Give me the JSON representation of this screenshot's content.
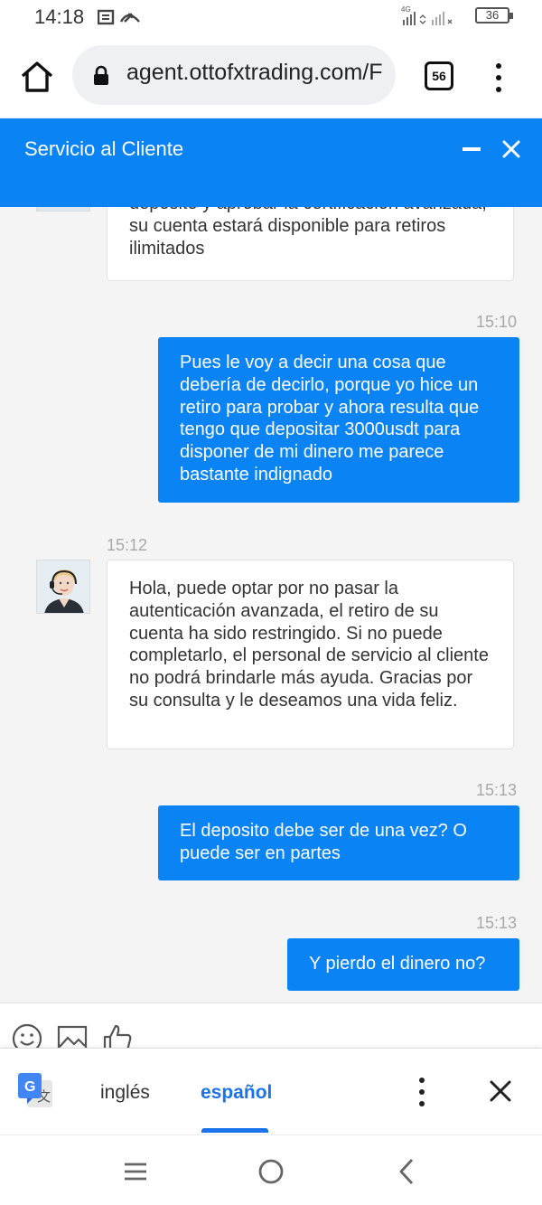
{
  "status_bar": {
    "time": "14:18",
    "network": "4G",
    "battery": "36"
  },
  "browser": {
    "url": "agent.ottofxtrading.com/F",
    "tab_count": "56"
  },
  "chat": {
    "title": "Servicio al Cliente",
    "messages": [
      {
        "sender": "agent",
        "text": "deposito y aprobar la certificacion avanzada, su cuenta estará disponible para retiros ilimitados"
      },
      {
        "sender": "user",
        "time": "15:10",
        "text": "Pues le voy a decir una cosa que debería de decirlo, porque yo hice un retiro para probar y ahora resulta que tengo que depositar 3000usdt para disponer de mi dinero me parece bastante indignado"
      },
      {
        "sender": "agent",
        "time": "15:12",
        "text": "Hola, puede optar por no pasar la autenticación avanzada, el retiro de su cuenta ha sido restringido. Si no puede completarlo, el personal de servicio al cliente no podrá brindarle más ayuda. Gracias por su consulta y le deseamos una vida feliz."
      },
      {
        "sender": "user",
        "time": "15:13",
        "text": "El deposito debe ser de una vez? O puede ser en partes"
      },
      {
        "sender": "user",
        "time": "15:13",
        "text": "Y pierdo el dinero no?"
      }
    ]
  },
  "toolbar": {
    "icons": [
      "smiley-icon",
      "image-icon",
      "thumbs-up-icon"
    ]
  },
  "translate": {
    "lang_source": "inglés",
    "lang_target": "español"
  },
  "colors": {
    "accent": "#0a84f4",
    "translate_blue": "#1a73e8"
  }
}
